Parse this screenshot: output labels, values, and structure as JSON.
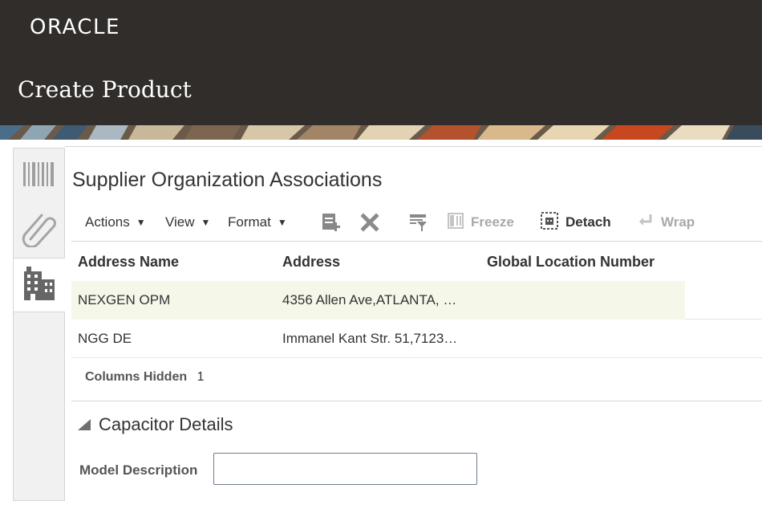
{
  "header": {
    "logo_text": "ORACLE",
    "page_title": "Create Product",
    "background": "#312d2a"
  },
  "left_tabs": [
    {
      "icon": "barcode-icon",
      "selected": false
    },
    {
      "icon": "paperclip-icon",
      "selected": false
    },
    {
      "icon": "building-icon",
      "selected": true
    }
  ],
  "section": {
    "title": "Supplier Organization Associations"
  },
  "toolbar": {
    "actions_label": "Actions",
    "view_label": "View",
    "format_label": "Format",
    "add_icon": "add-row-icon",
    "delete_icon": "delete-icon",
    "filter_icon": "query-by-example-icon",
    "freeze_label": "Freeze",
    "detach_label": "Detach",
    "wrap_label": "Wrap"
  },
  "table": {
    "columns": [
      "Address Name",
      "Address",
      "Global Location Number"
    ],
    "rows": [
      {
        "address_name": "NEXGEN OPM",
        "address": "4356 Allen Ave,ATLANTA, …",
        "gln": ""
      },
      {
        "address_name": "NGG DE",
        "address": "Immanel Kant Str. 51,7123…",
        "gln": ""
      }
    ],
    "columns_hidden_label": "Columns Hidden",
    "columns_hidden_count": "1"
  },
  "capacitor": {
    "title": "Capacitor Details",
    "model_description_label": "Model Description",
    "model_description_value": ""
  },
  "colors": {
    "selected_row": "#f5f7e9",
    "disabled_text": "#a9a9a9",
    "border": "#d6d6d6"
  }
}
